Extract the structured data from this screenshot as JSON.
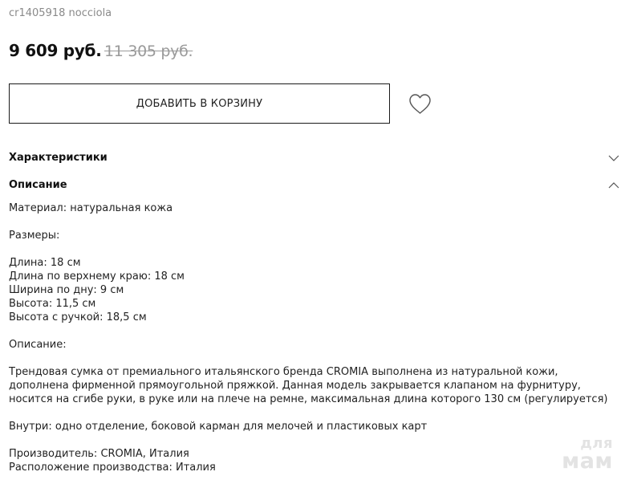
{
  "product": {
    "sku": "cr1405918 nocciola",
    "price": "9 609 руб.",
    "old_price": "11 305 руб.",
    "cart_button": "ДОБАВИТЬ В КОРЗИНУ",
    "favorite_icon": "heart-icon"
  },
  "sections": {
    "characteristics": {
      "title": "Характеристики",
      "icon": "chevron-down-icon"
    },
    "description": {
      "title": "Описание",
      "icon": "chevron-up-icon"
    }
  },
  "description_text": {
    "material": "Материал: натуральная кожа",
    "sizes_label": "Размеры:",
    "length": "Длина: 18 см",
    "top_length": "Длина по верхнему краю: 18 см",
    "bottom_width": "Ширина по дну: 9 см",
    "height": "Высота: 11,5 см",
    "handle_height": "Высота с ручкой: 18,5 см",
    "desc_label": "Описание:",
    "paragraph_1": "Трендовая сумка от премиального итальянского бренда CROMIA выполнена из натуральной кожи,",
    "paragraph_2": "дополнена фирменной прямоугольной пряжкой. Данная модель закрывается клапаном на фурнитуру,",
    "paragraph_3": "носится на сгибе руки, в руке или на плече на ремне, максимальная длина которого 130 см (регулируется)",
    "inside": "Внутри: одно отделение, боковой карман для мелочей и пластиковых карт",
    "manufacturer": "Производитель: CROMIA, Италия",
    "production": "Расположение производства: Италия"
  },
  "watermark": {
    "line1": "для",
    "line2": "мам"
  }
}
